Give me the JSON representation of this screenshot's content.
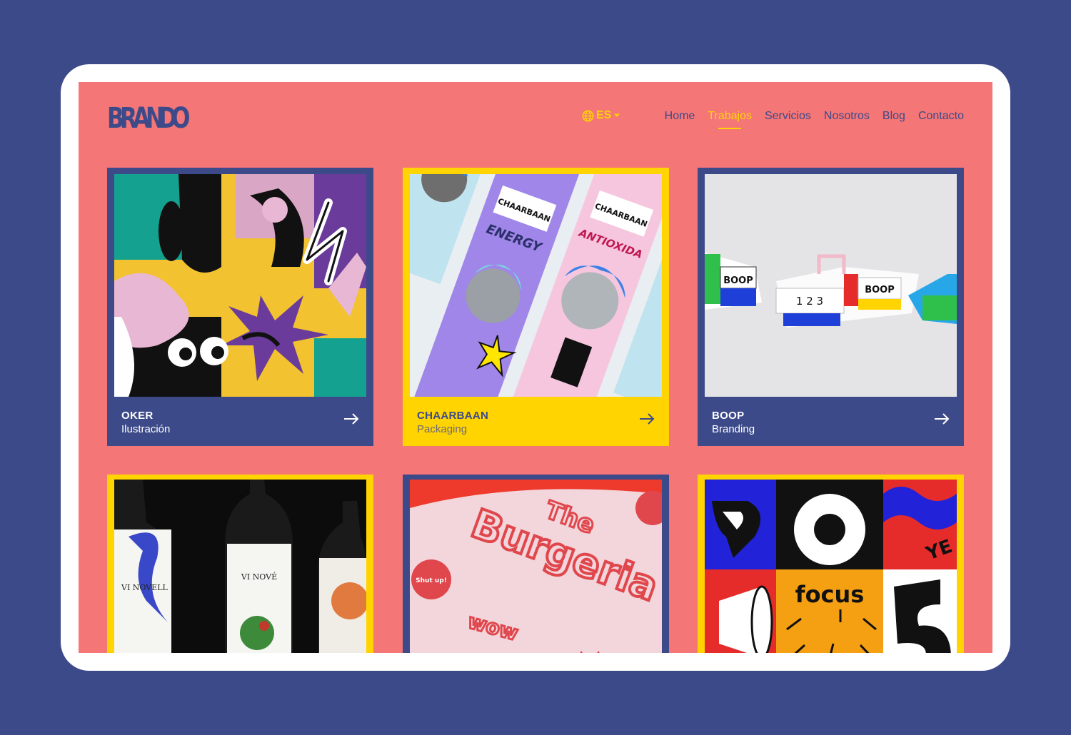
{
  "brand": {
    "logo_letters": [
      "B",
      "R",
      "A",
      "N",
      "D",
      "O"
    ]
  },
  "language": {
    "label": "ES"
  },
  "nav": {
    "items": [
      {
        "label": "Home",
        "active": false
      },
      {
        "label": "Trabajos",
        "active": true
      },
      {
        "label": "Servicios",
        "active": false
      },
      {
        "label": "Nosotros",
        "active": false
      },
      {
        "label": "Blog",
        "active": false
      },
      {
        "label": "Contacto",
        "active": false
      }
    ]
  },
  "projects": [
    {
      "title": "OKER",
      "category": "Ilustración"
    },
    {
      "title": "CHAARBAAN",
      "category": "Packaging"
    },
    {
      "title": "BOOP",
      "category": "Branding"
    },
    {
      "title": "",
      "category": ""
    },
    {
      "title": "",
      "category": ""
    },
    {
      "title": "",
      "category": ""
    }
  ],
  "artwork_text": {
    "chaarbaan_bar_1": "CHAARBAAN",
    "chaarbaan_bar_1_flavor": "ENERGY",
    "chaarbaan_bar_2": "CHAARBAAN",
    "chaarbaan_bar_2_flavor": "ANTIOXIDA",
    "boop_box_1": "BOOP",
    "boop_box_2": "BOOP",
    "boop_numbers": "1 2 3",
    "wine_label_1": "VI NOVELL",
    "wine_label_2": "VI NOVÉ",
    "burger_word_1": "The",
    "burger_word_2": "Burgeria",
    "burger_wow": "wow",
    "burger_sticker": "Shut up!",
    "poster_focus": "focus",
    "poster_ye": "YE"
  },
  "colors": {
    "page_bg": "#3d4a8a",
    "screen_bg": "#f47676",
    "navy": "#3d4a8a",
    "yellow": "#ffd400"
  }
}
